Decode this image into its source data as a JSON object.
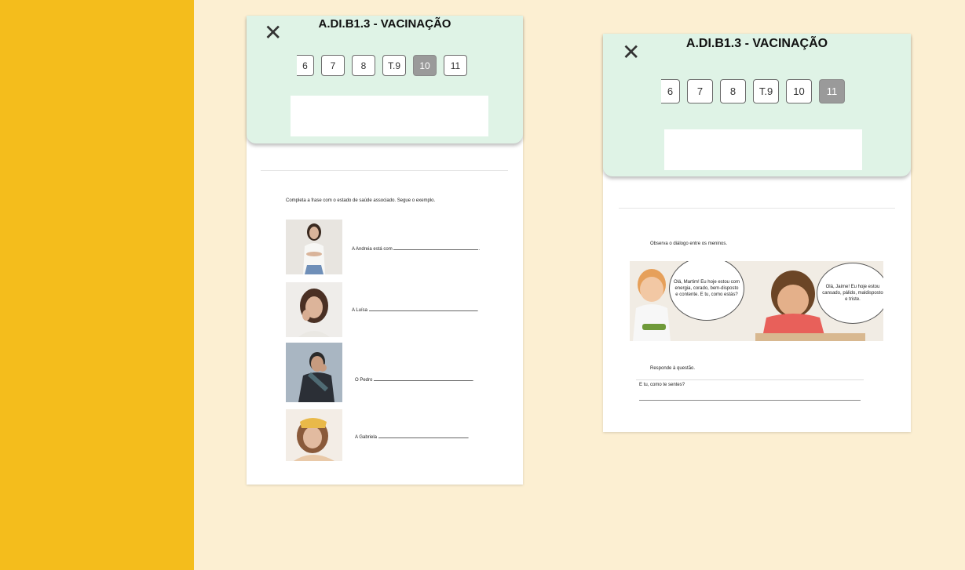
{
  "left_phone": {
    "title": "A.DI.B1.3 - VACINAÇÃO",
    "pager": [
      "6",
      "7",
      "8",
      "T.9",
      "10",
      "11"
    ],
    "active_page": "10",
    "instruction": "Completa a frase com o estado de saúde associado. Segue o exemplo.",
    "items": [
      {
        "sentence": "A Andreia está com",
        "end": "."
      },
      {
        "sentence": "A Luísa",
        "end": "."
      },
      {
        "sentence": "O Pedro",
        "end": "."
      },
      {
        "sentence": "A Gabriela",
        "end": "."
      }
    ]
  },
  "right_phone": {
    "title": "A.DI.B1.3 - VACINAÇÃO",
    "pager": [
      "6",
      "7",
      "8",
      "T.9",
      "10",
      "11"
    ],
    "active_page": "11",
    "instruction": "Observa o diálogo entre os meninos.",
    "bubble_left": "Olá, Martim! Eu hoje estou com energia, corado, bem-disposto e contente. E tu, como estás?",
    "bubble_right": "Olá, Jaime! Eu hoje estou cansado, pálido, maldisposto e triste.",
    "question_label": "Responde à questão.",
    "answer_prompt": "E tu, como te sentes?"
  },
  "colors": {
    "left_band": "#f4bd1c",
    "canvas": "#fcefd2",
    "header": "#dff3e6",
    "active_page": "#9a9a9a"
  }
}
